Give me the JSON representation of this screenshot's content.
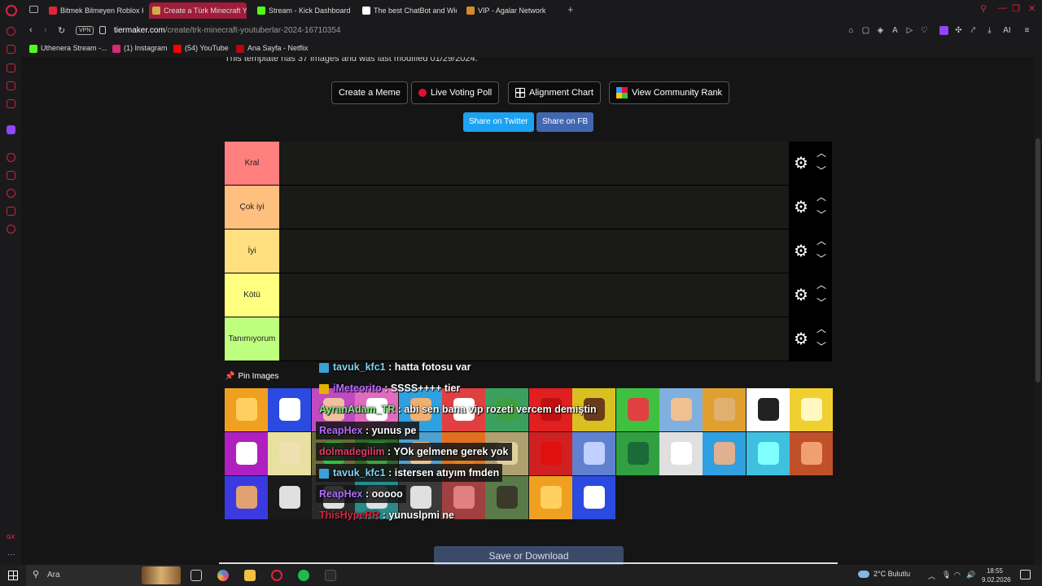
{
  "browser": {
    "tabs": [
      {
        "label": "Bitmek Bilmeyen Roblox K",
        "fav_color": "#e0243c"
      },
      {
        "label": "Create a Türk Minecraft Y",
        "fav_color": "#d6a84a",
        "active": true
      },
      {
        "label": "Stream - Kick Dashboard",
        "fav_color": "#53fc18"
      },
      {
        "label": "The best ChatBot and Wid",
        "fav_color": "#ffffff"
      },
      {
        "label": "VIP - Agalar Network",
        "fav_color": "#d68a2a"
      }
    ],
    "new_tab": "+",
    "url_host": "tiermaker.com",
    "url_path": "/create/trk-minecraft-youtuberlar-2024-16710354",
    "vpn_label": "VPN",
    "ai_label": "AI",
    "bookmarks": [
      {
        "label": "Uthenera Stream -...",
        "fav_color": "#53fc18"
      },
      {
        "label": "(1) Instagram",
        "fav_color": "#d62976"
      },
      {
        "label": "(54) YouTube",
        "fav_color": "#ff0000"
      },
      {
        "label": "Ana Sayfa - Netflix",
        "fav_color": "#b20710"
      }
    ],
    "sidebar_gx": "GX",
    "accent": "#e0243c"
  },
  "page": {
    "template_info": "This template has 37 images and was last modified 01/29/2024.",
    "buttons": {
      "create_meme": "Create a Meme",
      "live_poll": "Live Voting Poll",
      "alignment": "Alignment Chart",
      "community": "View Community Rank"
    },
    "share_twitter": "Share on Twitter",
    "share_fb": "Share on FB",
    "tiers": [
      {
        "label": "Kral",
        "color": "#ff7f7f"
      },
      {
        "label": "Çok iyi",
        "color": "#ffbf7f"
      },
      {
        "label": "İyi",
        "color": "#ffdf7f"
      },
      {
        "label": "Kötü",
        "color": "#ffff7f"
      },
      {
        "label": "Tanımıyorum",
        "color": "#bfff7f"
      }
    ],
    "pin_images": "Pin Images",
    "save_download": "Save or Download"
  },
  "chat": [
    {
      "user": "tavuk_kfc1",
      "msg": "hatta fotosu var",
      "color": "#7fd3f2",
      "badge": "#3aa0d8"
    },
    {
      "user": "iMeteorito",
      "msg": "SSSS++++ tier",
      "color": "#b96cff",
      "badge": "#e6b000"
    },
    {
      "user": "AyranAdam_TR",
      "msg": "abi sen bana vip rozeti vercem demiştin",
      "color": "#7ef07e",
      "badge": ""
    },
    {
      "user": "ReapHex",
      "msg": "yunus pe",
      "color": "#b06cff",
      "badge": ""
    },
    {
      "user": "dolmadegilim",
      "msg": "YOk gelmene gerek yok",
      "color": "#e03a6a",
      "badge": ""
    },
    {
      "user": "tavuk_kfc1",
      "msg": "istersen atıyım fmden",
      "color": "#7fd3f2",
      "badge": "#3aa0d8"
    },
    {
      "user": "ReapHex",
      "msg": "ooooo",
      "color": "#b06cff",
      "badge": ""
    },
    {
      "user": "ThisHypeRR",
      "msg": "yunuslpmi ne",
      "color": "#e0243c",
      "badge": ""
    }
  ],
  "taskbar": {
    "search_placeholder": "Ara",
    "weather": "2°C  Bulutlu",
    "time": "18:55",
    "date": "9.02.2026"
  }
}
